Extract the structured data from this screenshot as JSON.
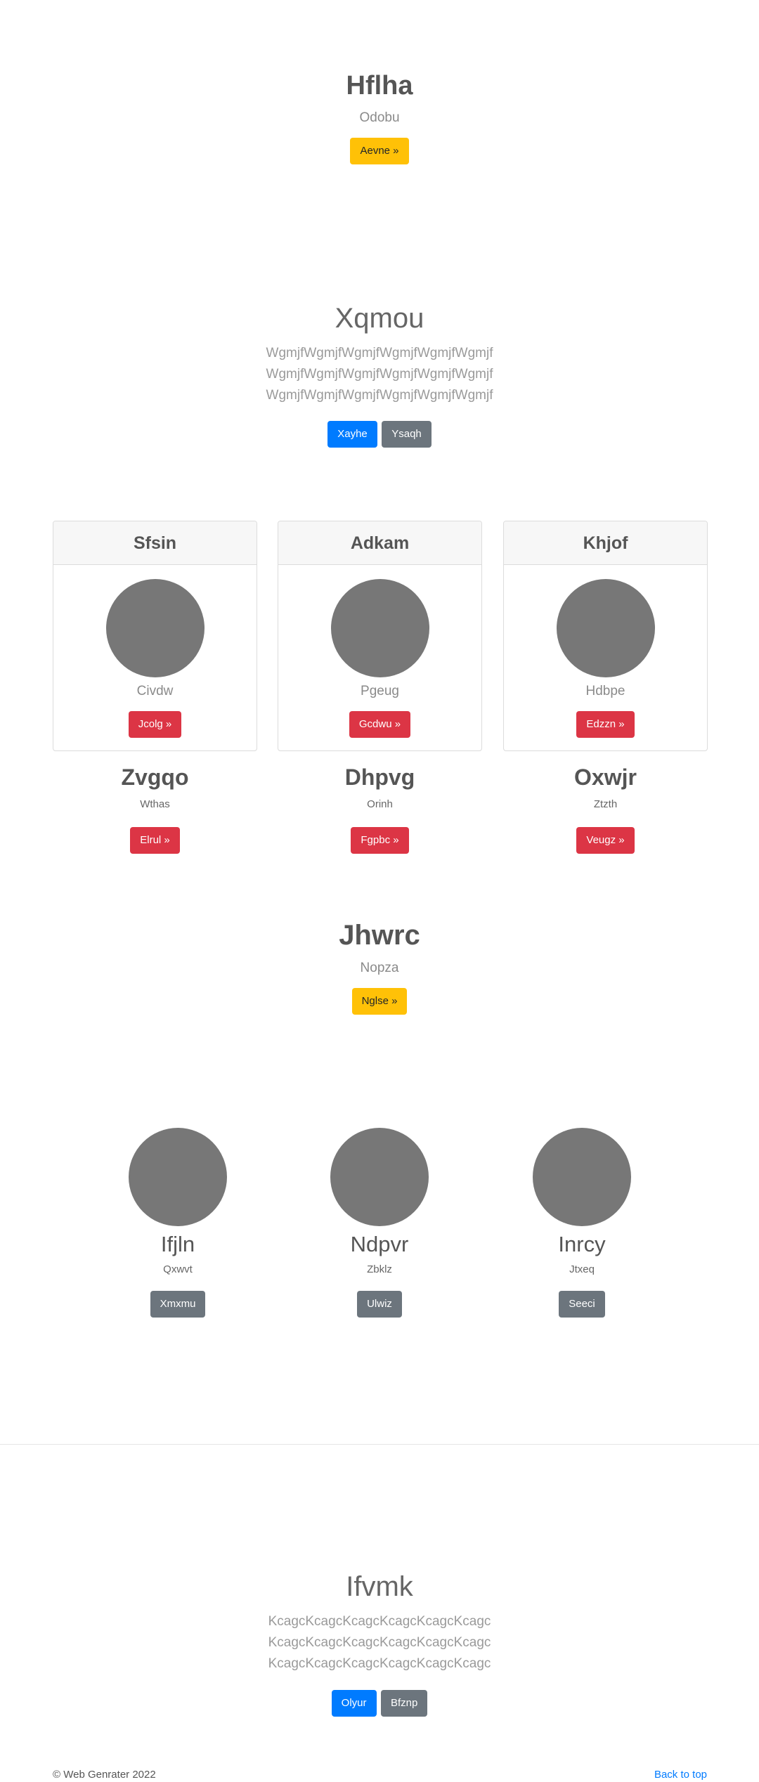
{
  "hero1": {
    "title": "Hflha",
    "subtitle": "Odobu",
    "button": "Aevne »"
  },
  "hero2": {
    "title": "Xqmou",
    "paragraph": "WgmjfWgmjfWgmjfWgmjfWgmjfWgmjfWgmjfWgmjfWgmjfWgmjfWgmjfWgmjfWgmjfWgmjfWgmjfWgmjfWgmjfWgmjf",
    "primary_button": "Xayhe",
    "secondary_button": "Ysaqh"
  },
  "cards": [
    {
      "header": "Sfsin",
      "caption": "Civdw",
      "button": "Jcolg »"
    },
    {
      "header": "Adkam",
      "caption": "Pgeug",
      "button": "Gcdwu »"
    },
    {
      "header": "Khjof",
      "caption": "Hdbpe",
      "button": "Edzzn »"
    }
  ],
  "columns": [
    {
      "title": "Zvgqo",
      "text": "Wthas",
      "button": "Elrul »"
    },
    {
      "title": "Dhpvg",
      "text": "Orinh",
      "button": "Fgpbc »"
    },
    {
      "title": "Oxwjr",
      "text": "Ztzth",
      "button": "Veugz »"
    }
  ],
  "hero3": {
    "title": "Jhwrc",
    "subtitle": "Nopza",
    "button": "Nglse »"
  },
  "circles": [
    {
      "title": "Ifjln",
      "text": "Qxwvt",
      "button": "Xmxmu"
    },
    {
      "title": "Ndpvr",
      "text": "Zbklz",
      "button": "Ulwiz"
    },
    {
      "title": "Inrcy",
      "text": "Jtxeq",
      "button": "Seeci"
    }
  ],
  "hero4": {
    "title": "Ifvmk",
    "paragraph": "KcagcKcagcKcagcKcagcKcagcKcagc KcagcKcagcKcagcKcagcKcagcKcagc KcagcKcagcKcagcKcagcKcagcKcagc",
    "primary_button": "Olyur",
    "secondary_button": "Bfznp"
  },
  "footer": {
    "copyright": "© Web Genrater 2022",
    "back_to_top": "Back to top"
  },
  "colors": {
    "warning": "#ffc107",
    "primary": "#007bff",
    "secondary": "#6c757d",
    "danger": "#dc3545",
    "placeholder": "#777777"
  }
}
